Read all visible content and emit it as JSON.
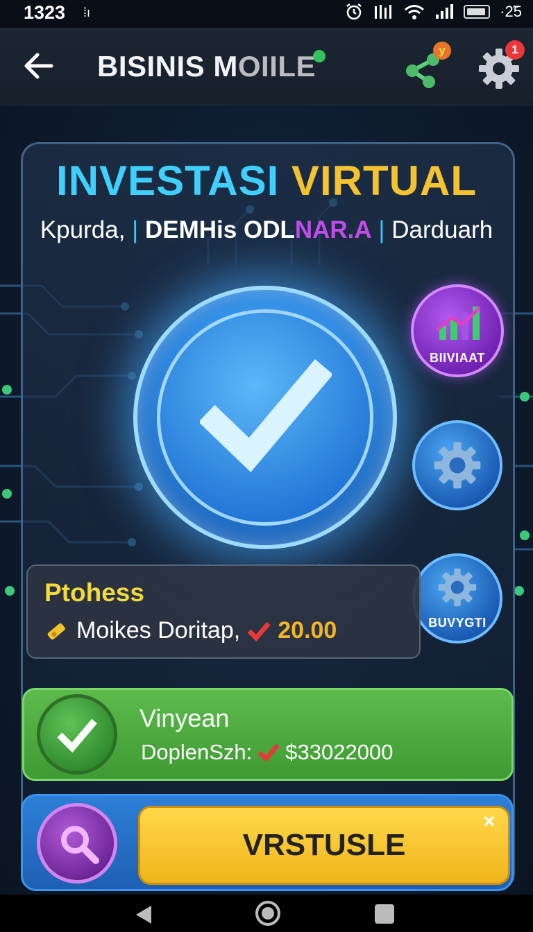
{
  "status_bar": {
    "time": "1323",
    "small_indicator": "⁞ı",
    "icons": [
      "alarm-icon",
      "signal-icon",
      "wifi-icon",
      "cell-signal-icon",
      "battery-icon"
    ],
    "battery_text": "·2̃5"
  },
  "app_bar": {
    "back_icon": "arrow-left-icon",
    "title": "BISINIS M",
    "title_tail": "OIILE",
    "share_badge": "y",
    "settings_badge": "1"
  },
  "hero": {
    "headline_part1": "INVESTASI",
    "headline_part2": "VIRTUAL",
    "sub_part1": "Kpurda,",
    "sub_part2": "DEMHis",
    "sub_part3a": "ODL",
    "sub_part3b": "NAR.A",
    "sub_part4": "Darduarh"
  },
  "side_buttons": {
    "top_label": "BIIVIAAT",
    "bottom_label": "BUVYGTI"
  },
  "progress": {
    "title": "Ptohess",
    "description": "Moikes Doritap,",
    "amount": "20.00"
  },
  "result": {
    "title": "Vinyean",
    "label": "DoplenSzh:",
    "amount": "$33022000"
  },
  "action": {
    "button_label": "VRSTUSLE",
    "close_label": "×"
  },
  "colors": {
    "accent_cyan": "#3fd0ff",
    "accent_gold": "#f5c230",
    "green_panel": "#4aa93c",
    "blue_panel": "#2470c8",
    "yellow_button": "#f7c42c"
  }
}
